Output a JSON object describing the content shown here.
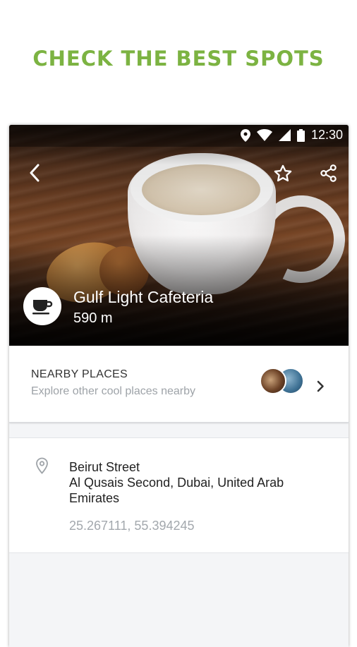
{
  "headline": "CHECK THE BEST SPOTS",
  "status_bar": {
    "time": "12:30"
  },
  "place": {
    "name": "Gulf Light Cafeteria",
    "distance": "590 m",
    "category_icon": "coffee-cup-icon"
  },
  "nearby": {
    "title": "NEARBY PLACES",
    "subtitle": "Explore other cool places nearby"
  },
  "address": {
    "street": "Beirut Street",
    "city": "Al Qusais Second, Dubai, United Arab Emirates",
    "coordinates": "25.267111, 55.394245"
  },
  "colors": {
    "accent": "#7cb342",
    "secondary_text": "#9ea3a8"
  }
}
